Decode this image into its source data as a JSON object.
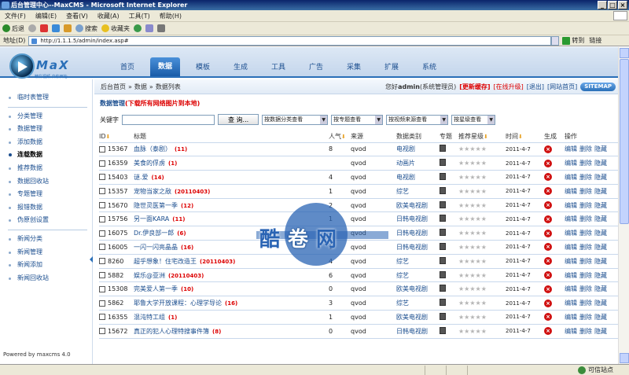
{
  "window": {
    "title": "后台管理中心--MaxCMS - Microsoft Internet Explorer"
  },
  "menu": [
    "文件(F)",
    "编辑(E)",
    "查看(V)",
    "收藏(A)",
    "工具(T)",
    "帮助(H)"
  ],
  "toolbar": {
    "back": "后退",
    "search": "搜索",
    "favorites": "收藏夹"
  },
  "address": {
    "label": "地址(D)",
    "url": "http://1.1.1.5/admin/index.asp#",
    "go": "转到",
    "links": "链接"
  },
  "status": {
    "zone": "可信站点"
  },
  "logo": {
    "name": "MaX",
    "slogan": "精彩视频 由你开始"
  },
  "nav": [
    "首页",
    "数据",
    "模板",
    "生成",
    "工具",
    "广告",
    "采集",
    "扩展",
    "系统"
  ],
  "sidebar": {
    "group1": [
      "临时表管理"
    ],
    "group2": [
      "分类管理",
      "数据管理",
      "添加数据",
      "连载数据",
      "推荐数据",
      "数据回收站",
      "专题管理",
      "报错数据",
      "伪原创设置"
    ],
    "group3": [
      "新闻分类",
      "新闻管理",
      "新闻添加",
      "新闻回收站"
    ],
    "powered": "Powered by maxcms 4.0"
  },
  "breadcrumb": [
    "后台首页",
    "»",
    "数据",
    "»",
    "数据列表"
  ],
  "topright": {
    "greeting": "您好",
    "user": "admin",
    "role": "(系统管理员)",
    "clear_cache": "[更新缓存]",
    "upgrade": "[在线升级]",
    "logout": "[退出]",
    "home": "[网站首页]",
    "sitemap": "SITEMAP"
  },
  "section": {
    "title": "数据管理",
    "note": "(下载所有网络图片到本地)"
  },
  "search": {
    "label": "关键字",
    "button": "查 询...",
    "selects": [
      "按数据分类查看",
      "按专题查看",
      "按视频来源查看",
      "按星级查看"
    ]
  },
  "table": {
    "headers": [
      "ID",
      "标题",
      "人气",
      "来源",
      "数据类别",
      "专题",
      "推荐星级",
      "时间",
      "生成",
      "操作"
    ],
    "ops": [
      "编辑",
      "删除",
      "隐藏"
    ],
    "rows": [
      {
        "id": "15367",
        "title": "血脉（泰剧）",
        "badge": "(11)",
        "hits": "8",
        "source": "qvod",
        "category": "电视剧",
        "time": "2011-4-7"
      },
      {
        "id": "16359",
        "title": "美食的俘虏",
        "badge": "(1)",
        "hits": "",
        "source": "qvod",
        "category": "动画片",
        "time": "2011-4-7"
      },
      {
        "id": "15403",
        "title": "谜.爱",
        "badge": "(14)",
        "hits": "4",
        "source": "qvod",
        "category": "电视剧",
        "time": "2011-4-7"
      },
      {
        "id": "15357",
        "title": "宠物当家之敌",
        "badge": "(20110403)",
        "hits": "1",
        "source": "qvod",
        "category": "综艺",
        "time": "2011-4-7"
      },
      {
        "id": "15670",
        "title": "隐世灵医第一季",
        "badge": "(12)",
        "hits": "2",
        "source": "qvod",
        "category": "欧美电视剧",
        "time": "2011-4-7"
      },
      {
        "id": "15756",
        "title": "另一面KARA",
        "badge": "(11)",
        "hits": "1",
        "source": "qvod",
        "category": "日韩电视剧",
        "time": "2011-4-7"
      },
      {
        "id": "16075",
        "title": "Dr.伊良部一郎",
        "badge": "(6)",
        "hits": "2",
        "source": "qvod",
        "category": "日韩电视剧",
        "time": "2011-4-7"
      },
      {
        "id": "16005",
        "title": "一闪一闪亮晶晶",
        "badge": "(16)",
        "hits": "1",
        "source": "qvod",
        "category": "日韩电视剧",
        "time": "2011-4-7"
      },
      {
        "id": "8260",
        "title": "超乎想象！住宅改造王",
        "badge": "(20110403)",
        "hits": "4",
        "source": "qvod",
        "category": "综艺",
        "time": "2011-4-7"
      },
      {
        "id": "5882",
        "title": "娱乐@亚洲",
        "badge": "(20110403)",
        "hits": "6",
        "source": "qvod",
        "category": "综艺",
        "time": "2011-4-7"
      },
      {
        "id": "15308",
        "title": "完美爱人第一季",
        "badge": "(10)",
        "hits": "0",
        "source": "qvod",
        "category": "欧美电视剧",
        "time": "2011-4-7"
      },
      {
        "id": "5862",
        "title": "耶鲁大学开放课程：心理学导论",
        "badge": "(16)",
        "hits": "3",
        "source": "qvod",
        "category": "综艺",
        "time": "2011-4-7"
      },
      {
        "id": "16355",
        "title": "混沌特工组",
        "badge": "(1)",
        "hits": "1",
        "source": "qvod",
        "category": "欧美电视剧",
        "time": "2011-4-7"
      },
      {
        "id": "15672",
        "title": "真正的犯人心理特搜事件簿",
        "badge": "(8)",
        "hits": "0",
        "source": "qvod",
        "category": "日韩电视剧",
        "time": "2011-4-7"
      }
    ]
  },
  "watermark": [
    "酷",
    "卷",
    "网"
  ]
}
